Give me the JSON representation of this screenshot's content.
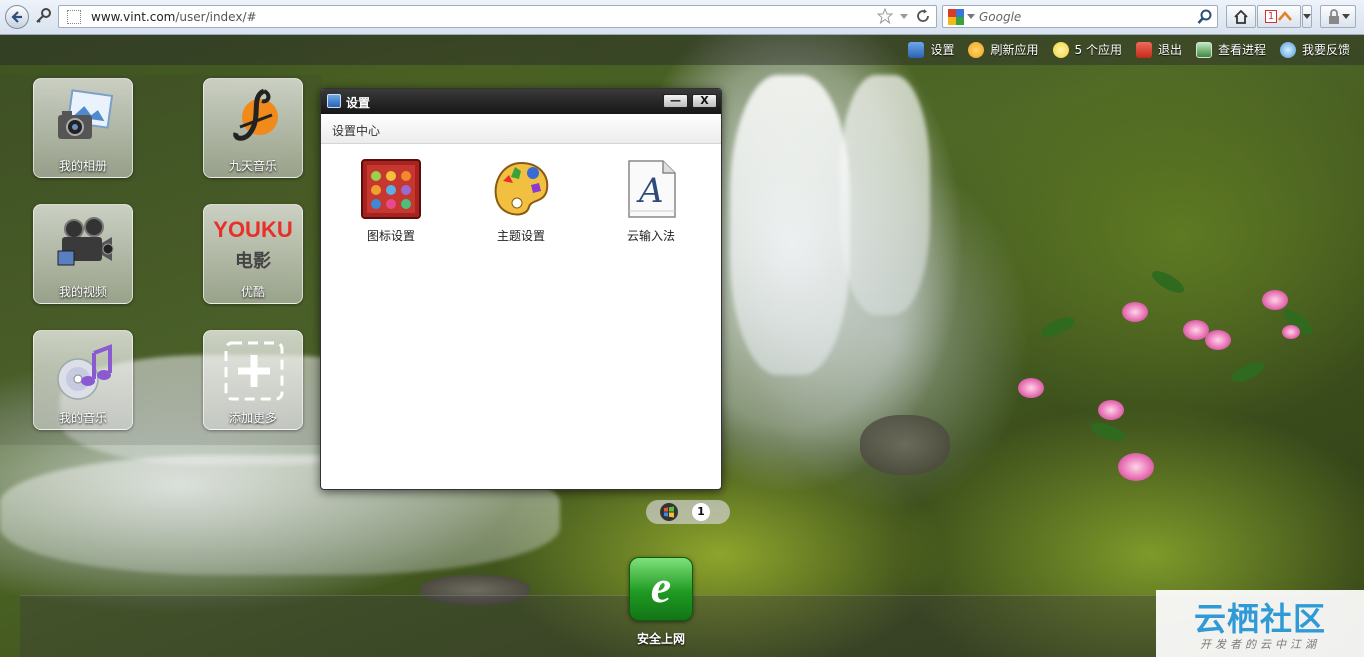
{
  "browser": {
    "url_host": "www.vint.com",
    "url_path": "/user/index/#",
    "search_placeholder": "Google",
    "tab_counter": "1"
  },
  "topbar": {
    "items": [
      {
        "label": "设置",
        "icon": "gear-icon",
        "color": "#2a62b3"
      },
      {
        "label": "刷新应用",
        "icon": "refresh-icon",
        "color": "#f0a21c"
      },
      {
        "label": "5 个应用",
        "icon": "smiley-icon",
        "color": "#f2d23a"
      },
      {
        "label": "退出",
        "icon": "power-icon",
        "color": "#d83a2a"
      },
      {
        "label": "查看进程",
        "icon": "monitor-icon",
        "color": "#3c8a3c"
      },
      {
        "label": "我要反馈",
        "icon": "chat-icon",
        "color": "#4a9ad8"
      }
    ]
  },
  "desktop": {
    "apps": [
      {
        "label": "我的相册",
        "icon": "photo-album-icon"
      },
      {
        "label": "九天音乐",
        "icon": "music-note-icon"
      },
      {
        "label": "我的视频",
        "icon": "video-camera-icon"
      },
      {
        "label": "优酷",
        "icon": "youku-logo",
        "logo_top": "YOUKU",
        "logo_bottom": "电影"
      },
      {
        "label": "我的音乐",
        "icon": "music-disc-icon"
      },
      {
        "label": "添加更多",
        "icon": "add-plus-icon"
      }
    ]
  },
  "settings_window": {
    "title": "设置",
    "subtitle": "设置中心",
    "minimize": "—",
    "close": "X",
    "items": [
      {
        "label": "图标设置",
        "icon": "icon-grid-icon"
      },
      {
        "label": "主题设置",
        "icon": "palette-icon"
      },
      {
        "label": "云输入法",
        "icon": "font-a-icon",
        "glyph": "A"
      }
    ]
  },
  "pager": {
    "current": "1"
  },
  "dock": {
    "items": [
      {
        "label": "安全上网",
        "icon": "ie-browser-icon",
        "glyph": "e"
      }
    ]
  },
  "watermark": {
    "main": "云栖社区",
    "sub": "开发者的云中江湖"
  }
}
